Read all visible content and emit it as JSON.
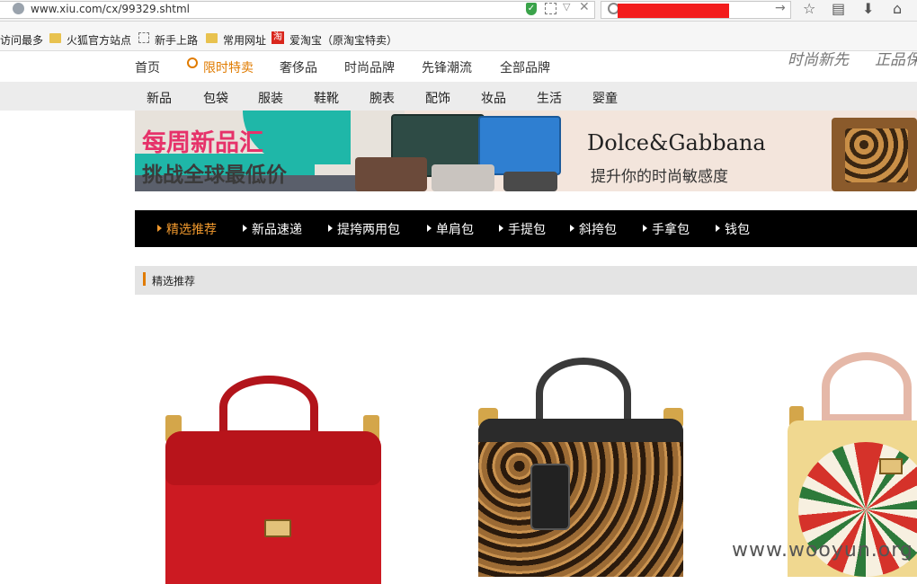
{
  "browser": {
    "url": "www.xiu.com/cx/99329.shtml",
    "bookmarks": [
      "访问最多",
      "火狐官方站点",
      "新手上路",
      "常用网址",
      "爱淘宝（原淘宝特卖）"
    ],
    "taobao_icon_text": "淘"
  },
  "site_nav": {
    "items": [
      "首页",
      "限时特卖",
      "奢侈品",
      "时尚品牌",
      "先锋潮流",
      "全部品牌"
    ],
    "slogans": [
      "时尚新先",
      "正品保"
    ]
  },
  "category_nav": {
    "items": [
      "新品",
      "包袋",
      "服装",
      "鞋靴",
      "腕表",
      "配饰",
      "妆品",
      "生活",
      "婴童"
    ]
  },
  "banner": {
    "title": "每周新品汇",
    "subtitle": "挑战全球最低价",
    "brand": "Dolce&Gabbana",
    "tagline": "提升你的时尚敏感度"
  },
  "tabs": {
    "items": [
      "精选推荐",
      "新品速递",
      "提挎两用包",
      "单肩包",
      "手提包",
      "斜挎包",
      "手拿包",
      "钱包"
    ],
    "active_index": 0
  },
  "section": {
    "title": "精选推荐"
  },
  "watermark": "www.wooyun.org",
  "colors": {
    "accent": "#e07b00",
    "tab_bar": "#000000",
    "banner_pink": "#e6326a",
    "redaction": "#f31b1b"
  }
}
